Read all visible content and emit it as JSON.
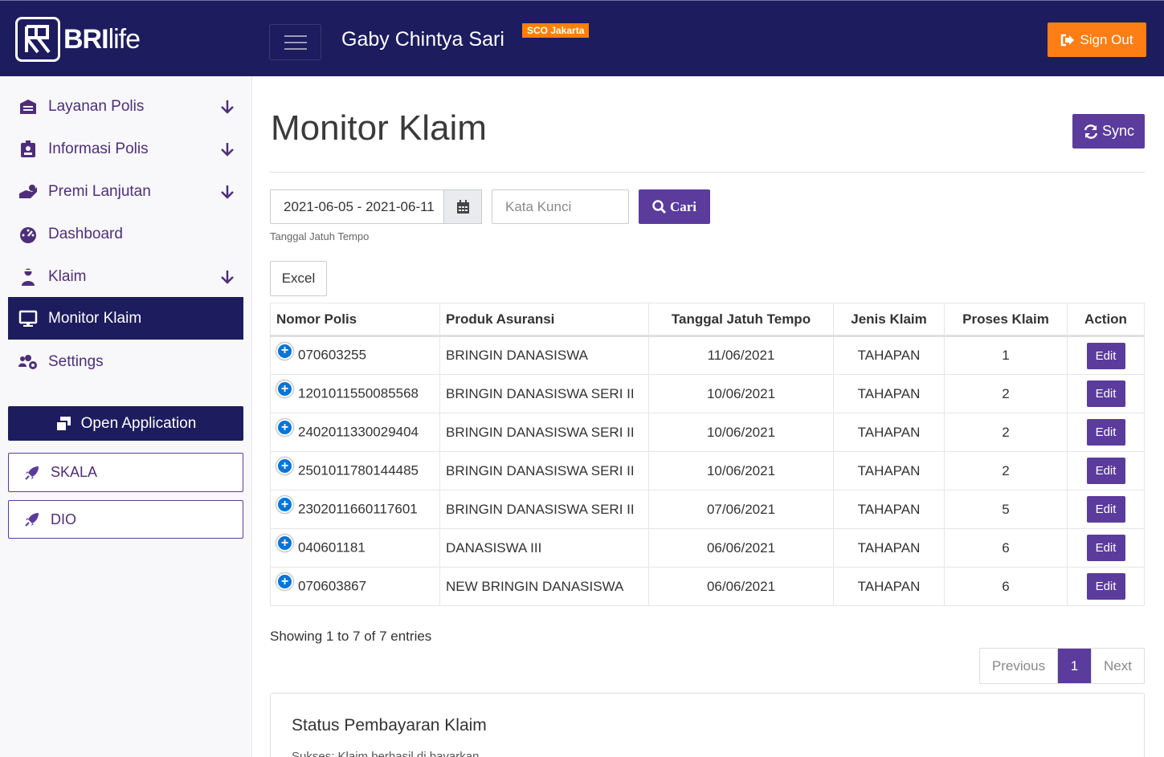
{
  "header": {
    "brand_bold": "BRI",
    "brand_light": "life",
    "user_name": "Gaby Chintya Sari",
    "location_badge": "SCO Jakarta",
    "signout_label": "Sign Out"
  },
  "sidebar": {
    "items": [
      {
        "label": "Layanan Polis",
        "icon": "building-icon",
        "has_arrow": true
      },
      {
        "label": "Informasi Polis",
        "icon": "id-badge-icon",
        "has_arrow": true
      },
      {
        "label": "Premi Lanjutan",
        "icon": "hand-money-icon",
        "has_arrow": true
      },
      {
        "label": "Dashboard",
        "icon": "tachometer-icon",
        "has_arrow": false
      },
      {
        "label": "Klaim",
        "icon": "user-injured-icon",
        "has_arrow": true
      },
      {
        "label": "Monitor Klaim",
        "icon": "monitor-icon",
        "has_arrow": false,
        "active": true
      },
      {
        "label": "Settings",
        "icon": "users-cog-icon",
        "has_arrow": false
      }
    ],
    "open_application": "Open Application",
    "external_apps": [
      "SKALA",
      "DIO"
    ]
  },
  "main": {
    "title": "Monitor Klaim",
    "sync_label": "Sync",
    "date_range_value": "2021-06-05 - 2021-06-11",
    "date_help": "Tanggal Jatuh Tempo",
    "keyword_placeholder": "Kata Kunci",
    "search_label": "Cari",
    "excel_label": "Excel",
    "table": {
      "columns": [
        "Nomor Polis",
        "Produk Asuransi",
        "Tanggal Jatuh Tempo",
        "Jenis Klaim",
        "Proses Klaim",
        "Action"
      ],
      "rows": [
        {
          "polis": "070603255",
          "produk": "BRINGIN DANASISWA",
          "tanggal": "11/06/2021",
          "jenis": "TAHAPAN",
          "proses": "1",
          "action": "Edit"
        },
        {
          "polis": "1201011550085568",
          "produk": "BRINGIN DANASISWA SERI II",
          "tanggal": "10/06/2021",
          "jenis": "TAHAPAN",
          "proses": "2",
          "action": "Edit"
        },
        {
          "polis": "2402011330029404",
          "produk": "BRINGIN DANASISWA SERI II",
          "tanggal": "10/06/2021",
          "jenis": "TAHAPAN",
          "proses": "2",
          "action": "Edit"
        },
        {
          "polis": "2501011780144485",
          "produk": "BRINGIN DANASISWA SERI II",
          "tanggal": "10/06/2021",
          "jenis": "TAHAPAN",
          "proses": "2",
          "action": "Edit"
        },
        {
          "polis": "2302011660117601",
          "produk": "BRINGIN DANASISWA SERI II",
          "tanggal": "07/06/2021",
          "jenis": "TAHAPAN",
          "proses": "5",
          "action": "Edit"
        },
        {
          "polis": "040601181",
          "produk": "DANASISWA III",
          "tanggal": "06/06/2021",
          "jenis": "TAHAPAN",
          "proses": "6",
          "action": "Edit"
        },
        {
          "polis": "070603867",
          "produk": "NEW BRINGIN DANASISWA",
          "tanggal": "06/06/2021",
          "jenis": "TAHAPAN",
          "proses": "6",
          "action": "Edit"
        }
      ]
    },
    "entries_info": "Showing 1 to 7 of 7 entries",
    "pagination": {
      "previous": "Previous",
      "current": "1",
      "next": "Next"
    },
    "status_card": {
      "title": "Status Pembayaran Klaim",
      "subtitle": "Sukses: Klaim berhasil di bayarkan"
    }
  },
  "colors": {
    "navy": "#1c1c5e",
    "purple": "#5b3b9c",
    "orange": "#fd7e14",
    "plus_blue": "#0275d8"
  }
}
